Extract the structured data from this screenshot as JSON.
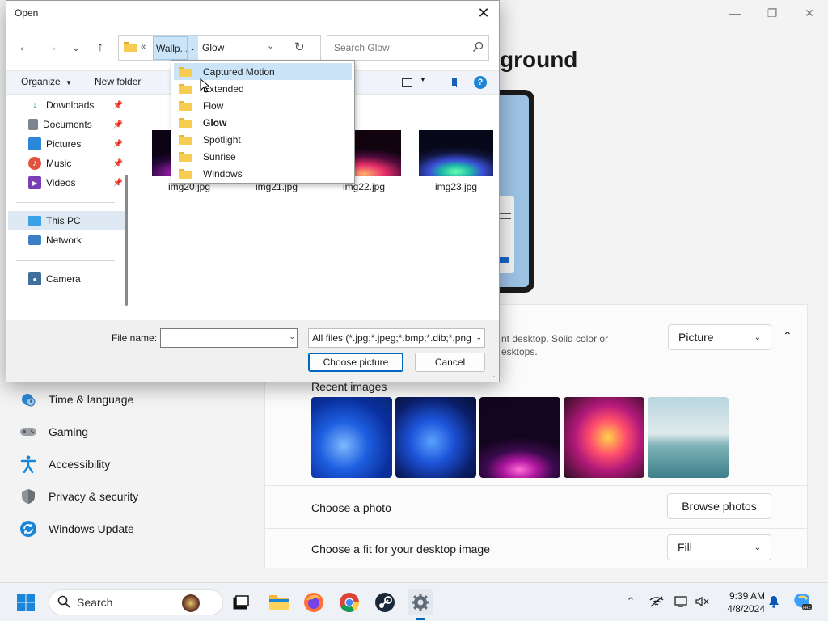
{
  "settings": {
    "heading_fragment": "ground",
    "nav_items": [
      {
        "label": "Time & language",
        "icon": "globe-clock-icon"
      },
      {
        "label": "Gaming",
        "icon": "gamepad-icon"
      },
      {
        "label": "Accessibility",
        "icon": "accessibility-icon"
      },
      {
        "label": "Privacy & security",
        "icon": "shield-icon"
      },
      {
        "label": "Windows Update",
        "icon": "update-icon"
      }
    ],
    "personalize": {
      "desc_line1": "nt desktop. Solid color or",
      "desc_line2": "esktops.",
      "type_value": "Picture"
    },
    "recent_images_label": "Recent images",
    "choose_photo_label": "Choose a photo",
    "browse_button": "Browse photos",
    "fit_label": "Choose a fit for your desktop image",
    "fit_value": "Fill",
    "colors": {
      "accent": "#0067c0"
    }
  },
  "dialog": {
    "title": "Open",
    "address": {
      "overflow": "«",
      "crumb": "Wallp...",
      "current": "Glow"
    },
    "search_placeholder": "Search Glow",
    "commands": {
      "organize": "Organize",
      "new_folder": "New folder"
    },
    "nav_pane": [
      {
        "label": "Downloads",
        "icon": "download-icon",
        "pinned": true
      },
      {
        "label": "Documents",
        "icon": "documents-icon",
        "pinned": true
      },
      {
        "label": "Pictures",
        "icon": "pictures-icon",
        "pinned": true
      },
      {
        "label": "Music",
        "icon": "music-icon",
        "pinned": true
      },
      {
        "label": "Videos",
        "icon": "videos-icon",
        "pinned": true
      },
      {
        "label": "This PC",
        "icon": "pc-icon",
        "pinned": false,
        "selected": true
      },
      {
        "label": "Network",
        "icon": "network-icon",
        "pinned": false
      },
      {
        "label": "Camera",
        "icon": "camera-icon",
        "pinned": false
      }
    ],
    "files": [
      {
        "name": "img20.jpg"
      },
      {
        "name": "img21.jpg"
      },
      {
        "name": "img22.jpg"
      },
      {
        "name": "img23.jpg"
      }
    ],
    "filename_label": "File name:",
    "filename_value": "",
    "filetype_value": "All files (*.jpg;*.jpeg;*.bmp;*.dib;*.png",
    "choose_button": "Choose picture",
    "cancel_button": "Cancel"
  },
  "folder_menu": {
    "items": [
      {
        "label": "Captured Motion",
        "highlighted": true,
        "bold": false
      },
      {
        "label": "Extended",
        "highlighted": false,
        "bold": false
      },
      {
        "label": "Flow",
        "highlighted": false,
        "bold": false
      },
      {
        "label": "Glow",
        "highlighted": false,
        "bold": true
      },
      {
        "label": "Spotlight",
        "highlighted": false,
        "bold": false
      },
      {
        "label": "Sunrise",
        "highlighted": false,
        "bold": false
      },
      {
        "label": "Windows",
        "highlighted": false,
        "bold": false
      }
    ]
  },
  "taskbar": {
    "search_label": "Search",
    "clock_time": "9:39 AM",
    "clock_date": "4/8/2024",
    "apps": [
      "start-icon",
      "task-view-icon",
      "file-explorer-icon",
      "firefox-icon",
      "chrome-icon",
      "steam-icon",
      "settings-icon"
    ]
  }
}
